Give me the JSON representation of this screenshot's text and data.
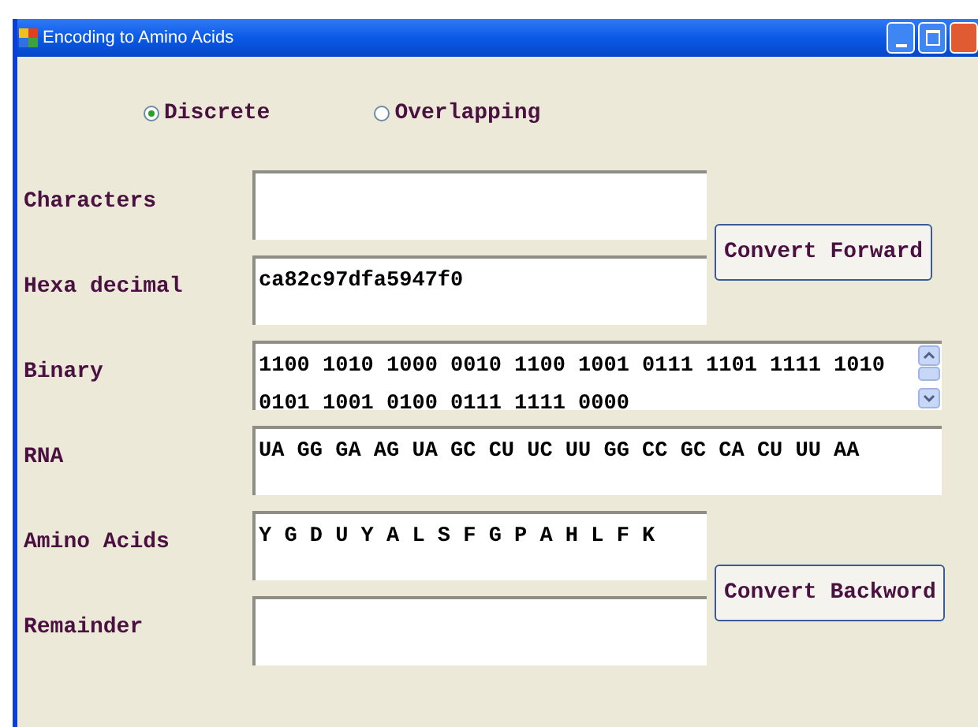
{
  "window": {
    "title": "Encoding to Amino Acids"
  },
  "options": [
    {
      "label": "Discrete",
      "selected": true
    },
    {
      "label": "Overlapping",
      "selected": false
    }
  ],
  "sections": [
    {
      "fields": [
        {
          "label": "Characters",
          "kind": "narrow"
        },
        {
          "label": "Hexa decimal",
          "value": "ca82c97dfa5947f0",
          "kind": "narrow"
        }
      ],
      "button": "Convert Forward"
    },
    {
      "fields": [
        {
          "label": "Binary",
          "value": "1100 1010 1000 0010 1100 1001 0111 1101 1111 1010 0101 1001 0100 0111 1111 0000",
          "kind": "scroll"
        },
        {
          "label": "RNA",
          "value": "UA GG GA AG UA GC CU UC UU GG CC GC CA CU UU AA",
          "kind": "wide"
        }
      ]
    },
    {
      "fields": [
        {
          "label": "Amino Acids",
          "value": "Y G D U Y A L S F G P A H L F K",
          "kind": "narrow"
        },
        {
          "label": "Remainder",
          "kind": "narrow"
        }
      ],
      "button": "Convert Backword"
    }
  ]
}
